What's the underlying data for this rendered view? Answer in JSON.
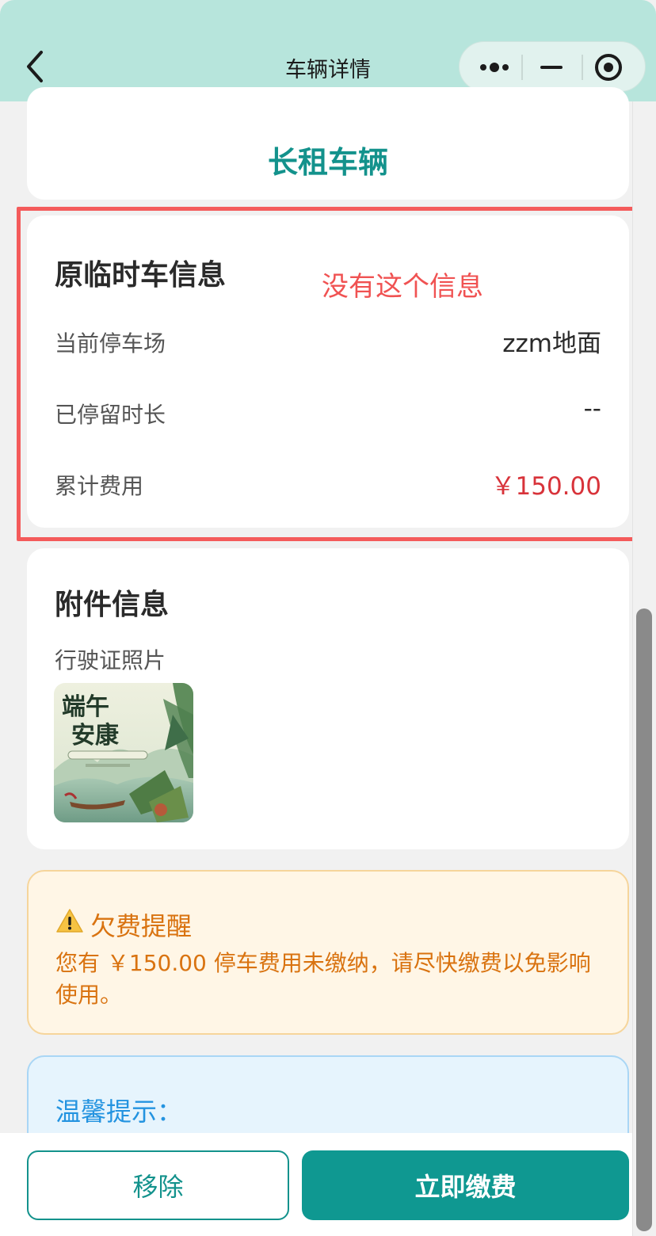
{
  "nav": {
    "title": "车辆详情"
  },
  "top_card": {
    "type_label": "长租车辆"
  },
  "info_card": {
    "title": "原临时车信息",
    "rows": [
      {
        "label": "当前停车场",
        "value": "zzm地面"
      },
      {
        "label": "已停留时长",
        "value": "--"
      },
      {
        "label": "累计费用",
        "value": "￥150.00"
      }
    ]
  },
  "annotation": {
    "text": "没有这个信息",
    "color": "#f05252"
  },
  "attachment_card": {
    "title": "附件信息",
    "photo_label": "行驶证照片"
  },
  "arrears": {
    "title": "欠费提醒",
    "message": "您有 ￥150.00 停车费用未缴纳，请尽快缴费以免影响使用。"
  },
  "tips": {
    "title": "温馨提示："
  },
  "actions": {
    "remove_label": "移除",
    "pay_label": "立即缴费"
  },
  "colors": {
    "accent": "#13928c",
    "header_bg": "#b7e5dc",
    "fee_red": "#d8333a",
    "warning": "#d97310",
    "tip_blue": "#2393e0"
  }
}
